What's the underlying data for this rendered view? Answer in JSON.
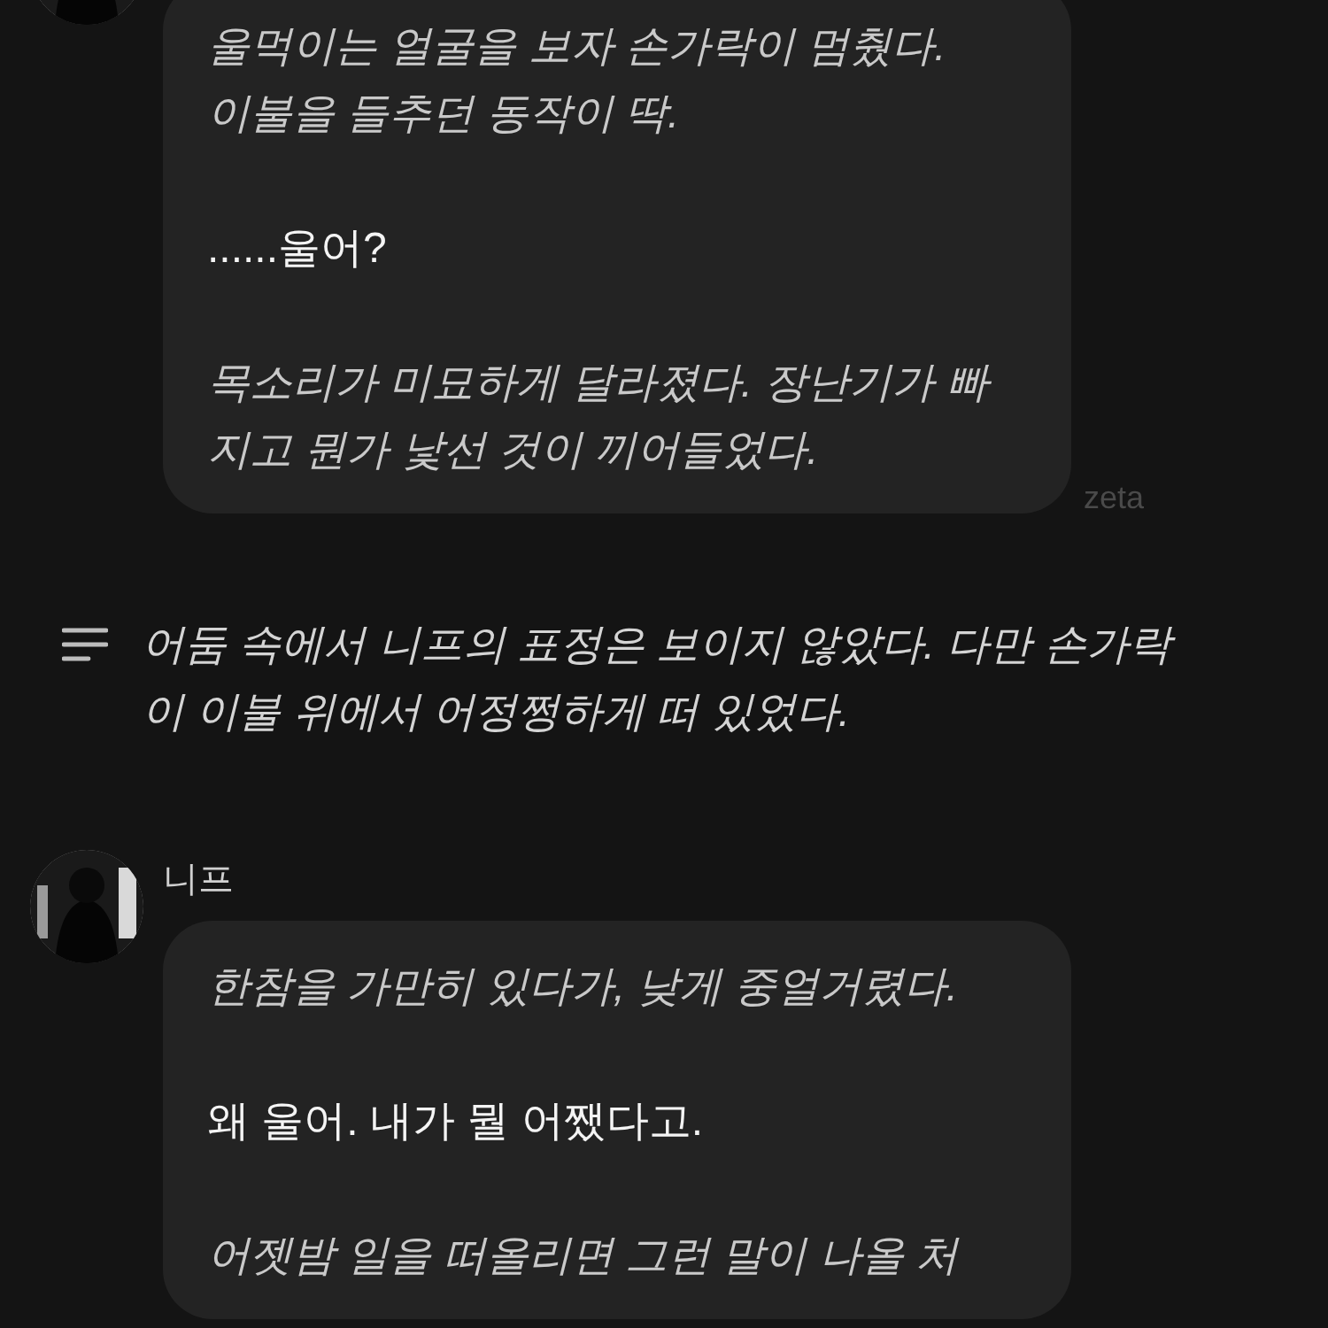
{
  "feed": [
    {
      "kind": "message",
      "paragraphs": [
        {
          "kind": "narration",
          "text": "울먹이는 얼굴을 보자 손가락이 멈췄다.\n이불을 들추던 동작이 딱."
        },
        {
          "kind": "speech",
          "text": "......울어?"
        },
        {
          "kind": "narration",
          "text": "목소리가 미묘하게 달라졌다. 장난기가 빠\n지고 뭔가 낯선 것이 끼어들었다."
        }
      ],
      "tag": "zeta"
    },
    {
      "kind": "narration",
      "text": "어둠 속에서 니프의 표정은 보이지 않았다. 다만 손가락\n이 이불 위에서 어정쩡하게 떠 있었다."
    },
    {
      "kind": "message",
      "name": "니프",
      "paragraphs": [
        {
          "kind": "narration",
          "text": "한참을 가만히 있다가, 낮게 중얼거렸다."
        },
        {
          "kind": "speech",
          "text": "왜 울어. 내가 뭘 어쨌다고."
        },
        {
          "kind": "narration",
          "text": "어젯밤 일을 떠올리면 그런 말이 나올 처"
        }
      ]
    }
  ]
}
